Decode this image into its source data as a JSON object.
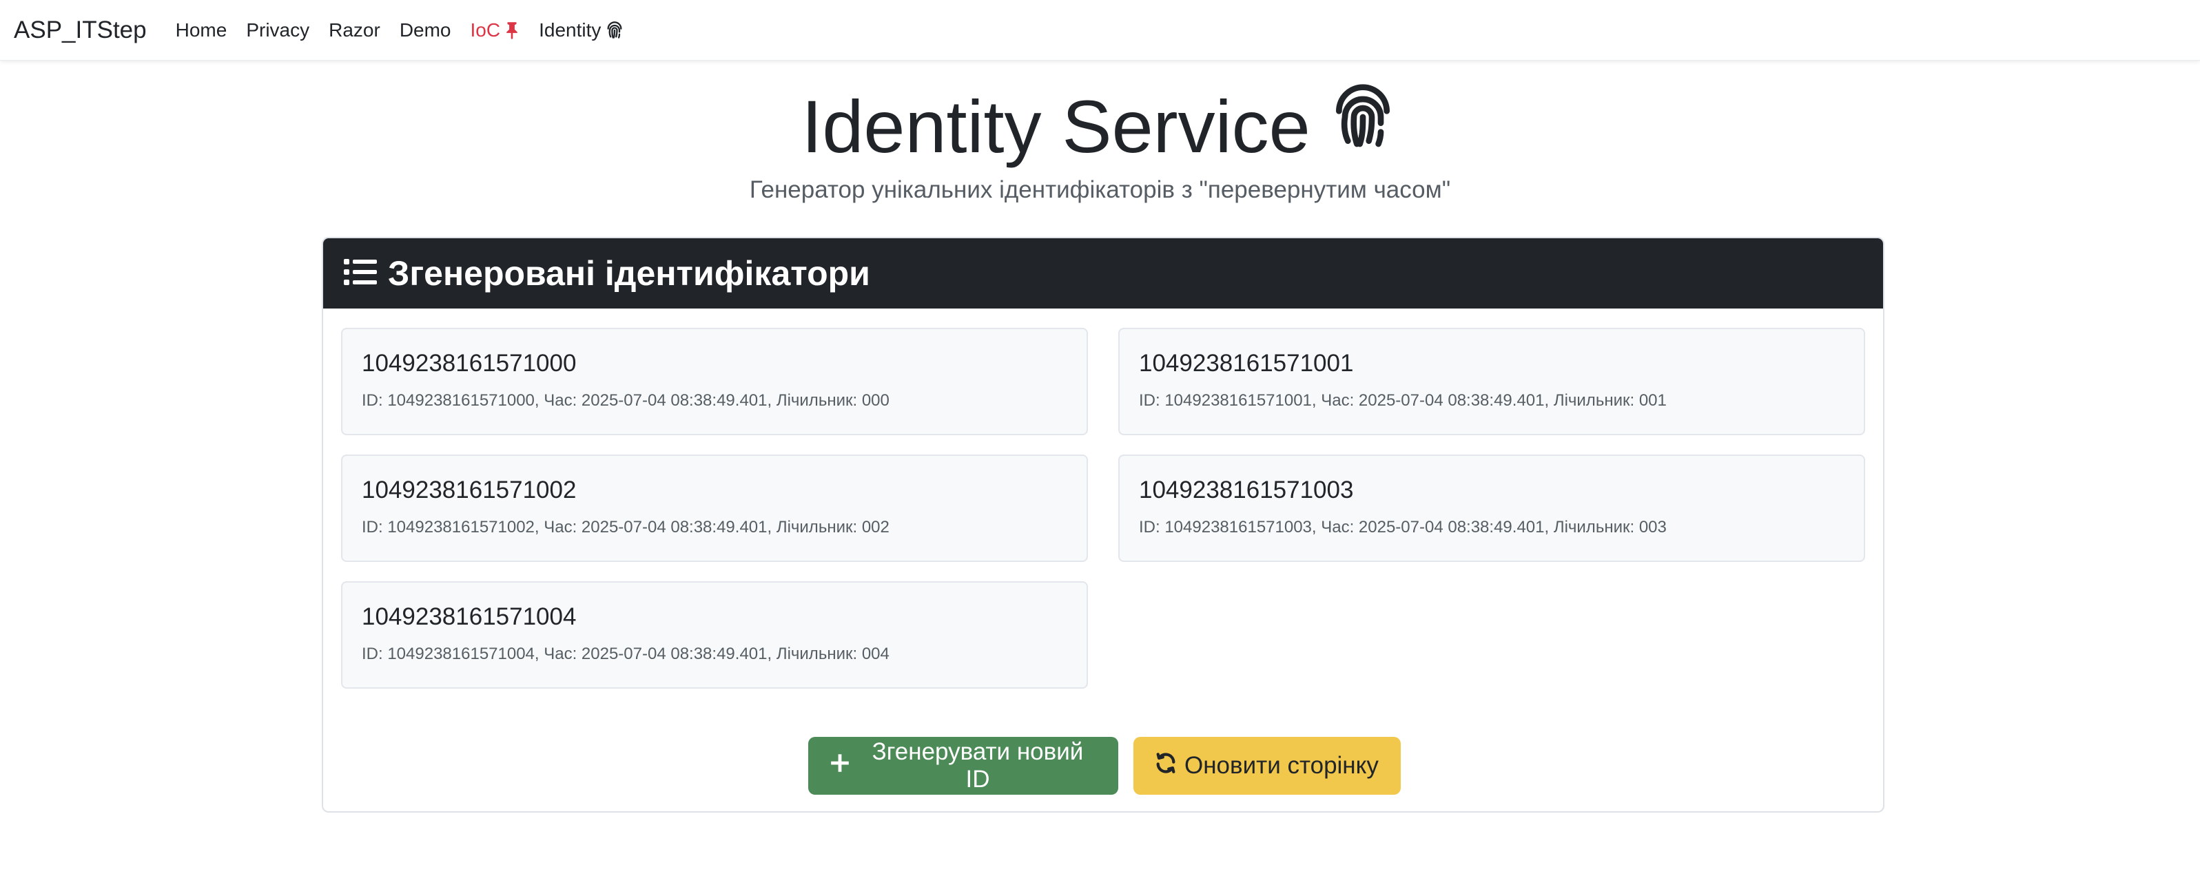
{
  "navbar": {
    "brand": "ASP_ITStep",
    "items": [
      {
        "label": "Home"
      },
      {
        "label": "Privacy"
      },
      {
        "label": "Razor"
      },
      {
        "label": "Demo"
      },
      {
        "label": "IoC",
        "icon": "pin-icon",
        "active": true,
        "color": "#dc3545"
      },
      {
        "label": "Identity",
        "icon": "fingerprint-icon"
      }
    ]
  },
  "hero": {
    "title": "Identity Service",
    "icon": "fingerprint-icon",
    "subtitle": "Генератор унікальних ідентифікаторів з \"перевернутим часом\""
  },
  "card": {
    "header_icon": "list-icon",
    "header_title": "Згенеровані ідентифікатори",
    "ids": [
      {
        "id": "1049238161571000",
        "desc": "ID: 1049238161571000, Час: 2025-07-04 08:38:49.401, Лічильник: 000"
      },
      {
        "id": "1049238161571001",
        "desc": "ID: 1049238161571001, Час: 2025-07-04 08:38:49.401, Лічильник: 001"
      },
      {
        "id": "1049238161571002",
        "desc": "ID: 1049238161571002, Час: 2025-07-04 08:38:49.401, Лічильник: 002"
      },
      {
        "id": "1049238161571003",
        "desc": "ID: 1049238161571003, Час: 2025-07-04 08:38:49.401, Лічильник: 003"
      },
      {
        "id": "1049238161571004",
        "desc": "ID: 1049238161571004, Час: 2025-07-04 08:38:49.401, Лічильник: 004"
      }
    ],
    "buttons": {
      "generate_label": "Згенерувати новий ID",
      "generate_icon": "plus-icon",
      "generate_color": "#4c8a57",
      "refresh_label": "Оновити сторінку",
      "refresh_icon": "refresh-icon",
      "refresh_color": "#f1c84b"
    }
  }
}
